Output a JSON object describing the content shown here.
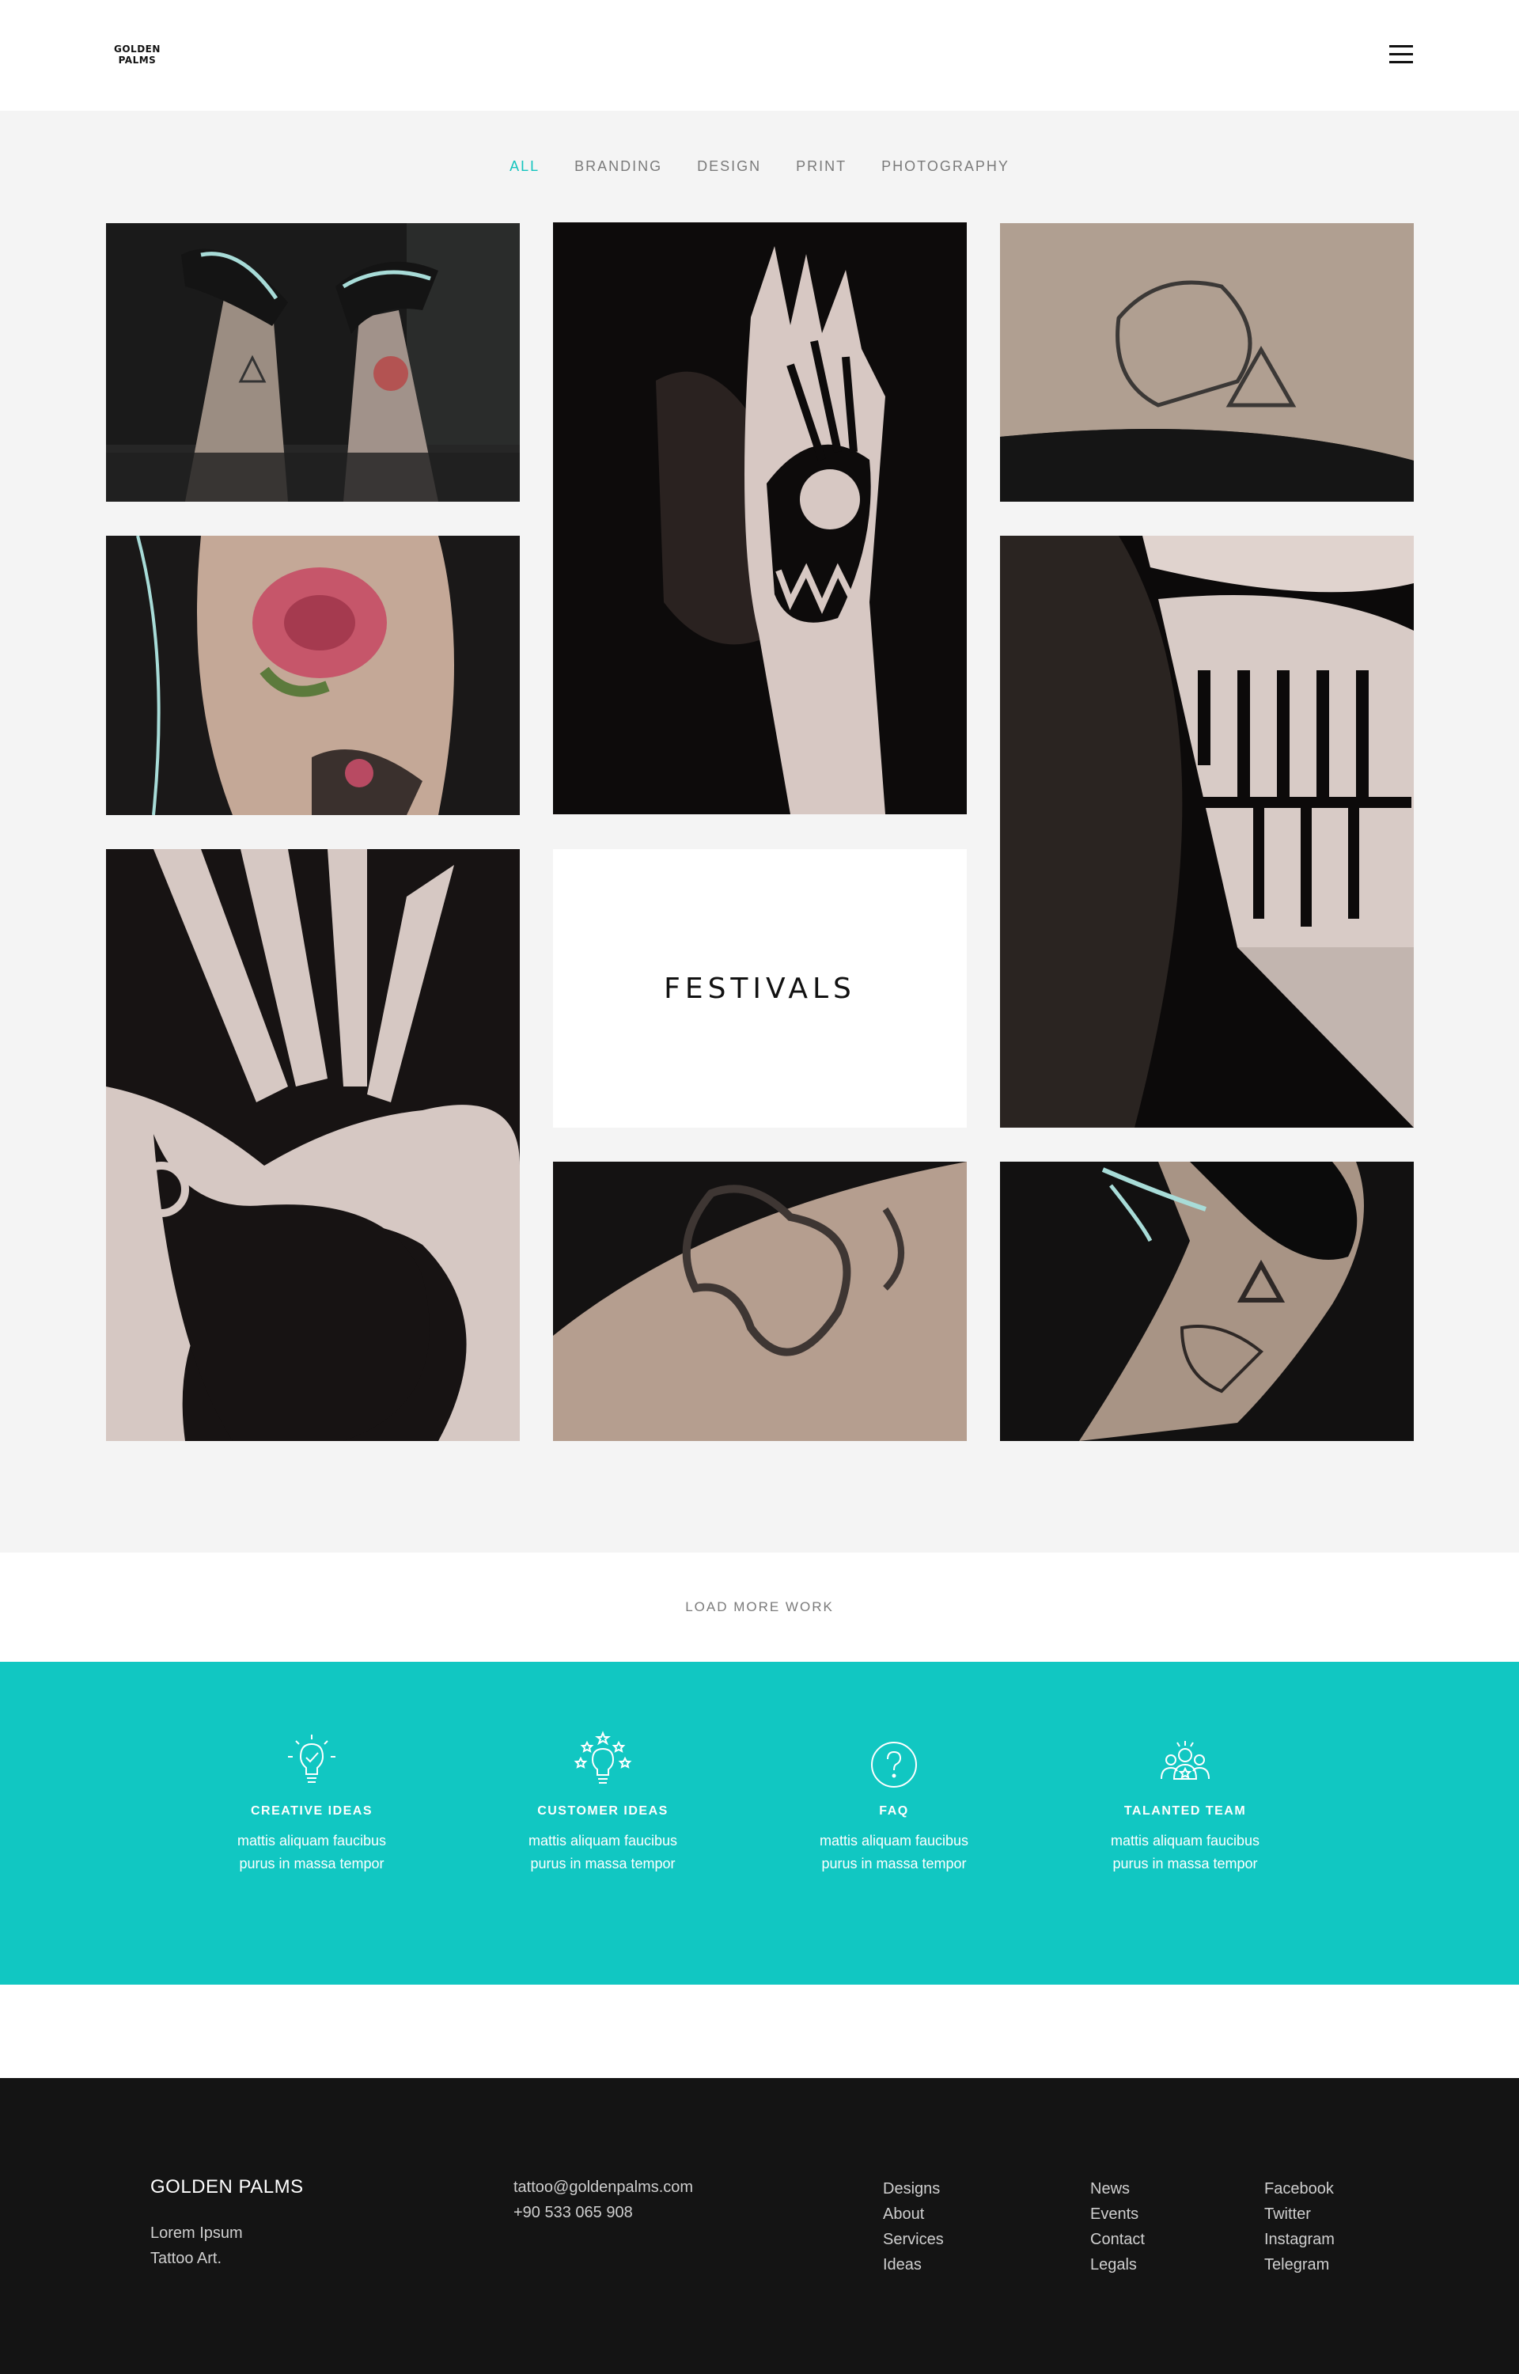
{
  "brand": {
    "logo_line1": "GOLDEN",
    "logo_line2": "PALMS"
  },
  "filters": [
    "ALL",
    "BRANDING",
    "DESIGN",
    "PRINT",
    "PHOTOGRAPHY"
  ],
  "active_filter": "ALL",
  "festival_tile": {
    "label": "FESTIVALS"
  },
  "load_more": "LOAD MORE WORK",
  "features": [
    {
      "icon": "lightbulb-check-icon",
      "title": "CREATIVE IDEAS",
      "desc1": "mattis aliquam faucibus",
      "desc2": "purus in massa tempor"
    },
    {
      "icon": "lightbulb-stars-icon",
      "title": "CUSTOMER IDEAS",
      "desc1": "mattis aliquam faucibus",
      "desc2": "purus in massa tempor"
    },
    {
      "icon": "question-circle-icon",
      "title": "FAQ",
      "desc1": "mattis aliquam faucibus",
      "desc2": "purus in massa tempor"
    },
    {
      "icon": "team-star-icon",
      "title": "TALANTED TEAM",
      "desc1": "mattis aliquam faucibus",
      "desc2": "purus in massa tempor"
    }
  ],
  "footer": {
    "brand": "GOLDEN PALMS",
    "tagline1": "Lorem Ipsum",
    "tagline2": "Tattoo Art.",
    "email": "tattoo@goldenpalms.com",
    "phone": "+90 533 065 908",
    "col1": [
      "Designs",
      "About",
      "Services",
      "Ideas"
    ],
    "col2": [
      "News",
      "Events",
      "Contact",
      "Legals"
    ],
    "col3": [
      "Facebook",
      "Twitter",
      "Instagram",
      "Telegram"
    ]
  },
  "colors": {
    "accent": "#11c7c2",
    "footer_bg": "#141414",
    "gallery_bg": "#f4f4f4"
  }
}
